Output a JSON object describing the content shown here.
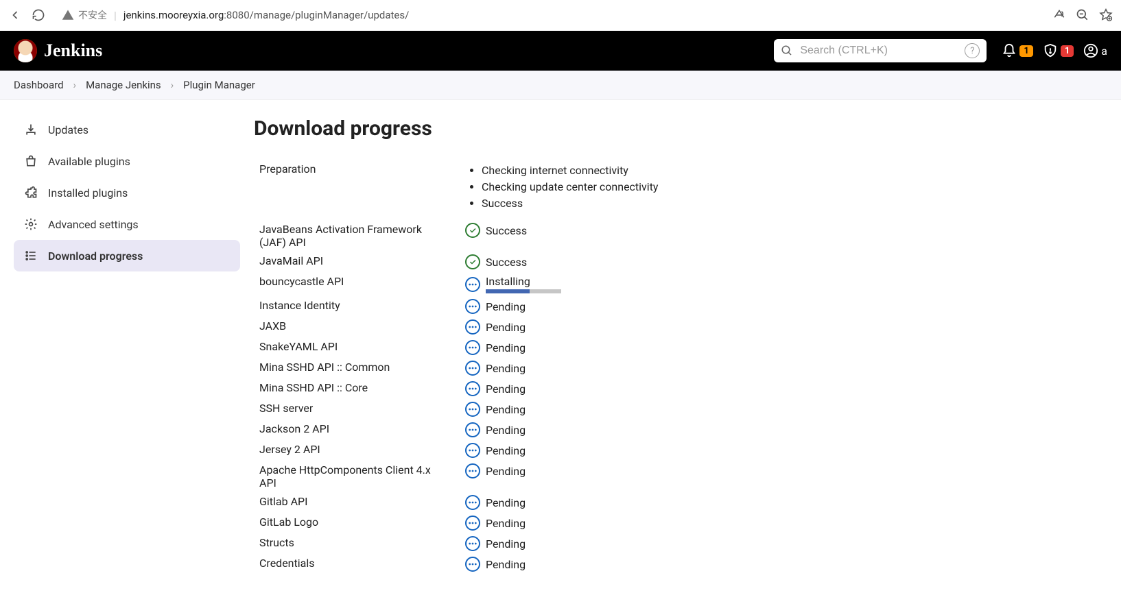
{
  "browser": {
    "insecure_label": "不安全",
    "url_host": "jenkins.mooreyxia.org",
    "url_port": ":8080",
    "url_path": "/manage/pluginManager/updates/"
  },
  "header": {
    "title": "Jenkins",
    "search_placeholder": "Search (CTRL+K)",
    "notif_count": "1",
    "alert_count": "1",
    "user_initial": "a"
  },
  "breadcrumb": {
    "items": [
      "Dashboard",
      "Manage Jenkins",
      "Plugin Manager"
    ]
  },
  "sidebar": {
    "items": [
      {
        "label": "Updates",
        "icon": "download"
      },
      {
        "label": "Available plugins",
        "icon": "bag"
      },
      {
        "label": "Installed plugins",
        "icon": "puzzle"
      },
      {
        "label": "Advanced settings",
        "icon": "gear"
      },
      {
        "label": "Download progress",
        "icon": "list",
        "active": true
      }
    ]
  },
  "page": {
    "title": "Download progress",
    "preparation_label": "Preparation",
    "preparation_steps": [
      "Checking internet connectivity",
      "Checking update center connectivity",
      "Success"
    ],
    "rows": [
      {
        "name": "JavaBeans Activation Framework (JAF) API",
        "status": "Success",
        "kind": "success"
      },
      {
        "name": "JavaMail API",
        "status": "Success",
        "kind": "success"
      },
      {
        "name": "bouncycastle API",
        "status": "Installing",
        "kind": "installing"
      },
      {
        "name": "Instance Identity",
        "status": "Pending",
        "kind": "pending"
      },
      {
        "name": "JAXB",
        "status": "Pending",
        "kind": "pending"
      },
      {
        "name": "SnakeYAML API",
        "status": "Pending",
        "kind": "pending"
      },
      {
        "name": "Mina SSHD API :: Common",
        "status": "Pending",
        "kind": "pending"
      },
      {
        "name": "Mina SSHD API :: Core",
        "status": "Pending",
        "kind": "pending"
      },
      {
        "name": "SSH server",
        "status": "Pending",
        "kind": "pending"
      },
      {
        "name": "Jackson 2 API",
        "status": "Pending",
        "kind": "pending"
      },
      {
        "name": "Jersey 2 API",
        "status": "Pending",
        "kind": "pending"
      },
      {
        "name": "Apache HttpComponents Client 4.x API",
        "status": "Pending",
        "kind": "pending"
      },
      {
        "name": "Gitlab API",
        "status": "Pending",
        "kind": "pending"
      },
      {
        "name": "GitLab Logo",
        "status": "Pending",
        "kind": "pending"
      },
      {
        "name": "Structs",
        "status": "Pending",
        "kind": "pending"
      },
      {
        "name": "Credentials",
        "status": "Pending",
        "kind": "pending"
      }
    ]
  }
}
